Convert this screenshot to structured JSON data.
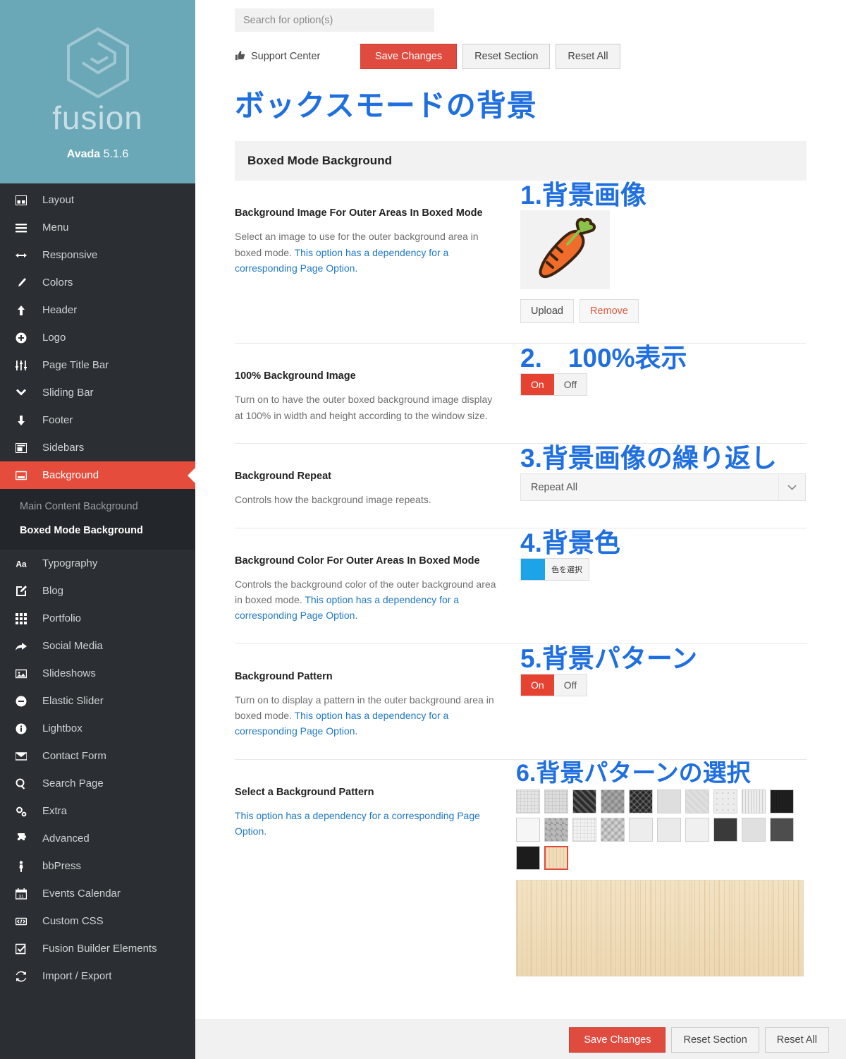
{
  "brand": {
    "wordmark": "fusion",
    "product": "Avada",
    "version": "5.1.6"
  },
  "sidebar": {
    "items": [
      {
        "label": "Layout",
        "icon": "layout-icon"
      },
      {
        "label": "Menu",
        "icon": "menu-icon"
      },
      {
        "label": "Responsive",
        "icon": "arrows-horizontal-icon"
      },
      {
        "label": "Colors",
        "icon": "brush-icon"
      },
      {
        "label": "Header",
        "icon": "arrow-up-icon"
      },
      {
        "label": "Logo",
        "icon": "plus-circle-icon"
      },
      {
        "label": "Page Title Bar",
        "icon": "sliders-icon"
      },
      {
        "label": "Sliding Bar",
        "icon": "chevron-down-icon"
      },
      {
        "label": "Footer",
        "icon": "arrow-down-icon"
      },
      {
        "label": "Sidebars",
        "icon": "sidebars-icon"
      },
      {
        "label": "Background",
        "icon": "background-icon",
        "active": true
      },
      {
        "label": "Typography",
        "icon": "typography-icon"
      },
      {
        "label": "Blog",
        "icon": "pencil-square-icon"
      },
      {
        "label": "Portfolio",
        "icon": "grid-icon"
      },
      {
        "label": "Social Media",
        "icon": "share-arrow-icon"
      },
      {
        "label": "Slideshows",
        "icon": "image-icon"
      },
      {
        "label": "Elastic Slider",
        "icon": "minus-circle-icon"
      },
      {
        "label": "Lightbox",
        "icon": "info-circle-icon"
      },
      {
        "label": "Contact Form",
        "icon": "envelope-icon"
      },
      {
        "label": "Search Page",
        "icon": "search-icon"
      },
      {
        "label": "Extra",
        "icon": "cogs-icon"
      },
      {
        "label": "Advanced",
        "icon": "puzzle-icon"
      },
      {
        "label": "bbPress",
        "icon": "person-icon"
      },
      {
        "label": "Events Calendar",
        "icon": "calendar-icon"
      },
      {
        "label": "Custom CSS",
        "icon": "code-icon"
      },
      {
        "label": "Fusion Builder Elements",
        "icon": "check-square-icon"
      },
      {
        "label": "Import / Export",
        "icon": "refresh-icon"
      }
    ],
    "submenu": [
      {
        "label": "Main Content Background",
        "current": false
      },
      {
        "label": "Boxed Mode Background",
        "current": true
      }
    ]
  },
  "topbar": {
    "search_placeholder": "Search for option(s)",
    "support_center": "Support Center",
    "save": "Save Changes",
    "reset_section": "Reset Section",
    "reset_all": "Reset All"
  },
  "page": {
    "title_jp": "ボックスモードの背景",
    "section_header": "Boxed Mode Background"
  },
  "options": {
    "bg_image": {
      "title": "Background Image For Outer Areas In Boxed Mode",
      "desc_plain": "Select an image to use for the outer background area in boxed mode. ",
      "desc_link": "This option has a dependency for a corresponding Page Option.",
      "annotation": "1.背景画像",
      "preview_icon": "carrot-image",
      "upload": "Upload",
      "remove": "Remove"
    },
    "full_image": {
      "title": "100% Background Image",
      "desc_plain": "Turn on to have the outer boxed background image display at 100% in width and height according to the window size.",
      "annotation": "2.　100%表示",
      "on": "On",
      "off": "Off",
      "value": "On"
    },
    "repeat": {
      "title": "Background Repeat",
      "desc_plain": "Controls how the background image repeats.",
      "annotation": "3.背景画像の繰り返し",
      "value": "Repeat All"
    },
    "bg_color": {
      "title": "Background Color For Outer Areas In Boxed Mode",
      "desc_plain": "Controls the background color of the outer background area in boxed mode. ",
      "desc_link": "This option has a dependency for a corresponding Page Option.",
      "annotation": "4.背景色",
      "swatch_hex": "#1CA3E8",
      "picker_label": "色を選択"
    },
    "bg_pattern": {
      "title": "Background Pattern",
      "desc_plain": "Turn on to display a pattern in the outer background area in boxed mode. ",
      "desc_link": "This option has a dependency for a corresponding Page Option.",
      "annotation": "5.背景パターン",
      "on": "On",
      "off": "Off",
      "value": "On"
    },
    "select_pattern": {
      "title": "Select a Background Pattern",
      "desc_link": "This option has a dependency for a corresponding Page Option.",
      "annotation": "6.背景パターンの選択",
      "selected_index": 21,
      "swatches": [
        {
          "name": "pattern-1",
          "color": "#e4e4e4",
          "style": "fine-grid"
        },
        {
          "name": "pattern-2",
          "color": "#dcdcdc",
          "style": "fine-grid"
        },
        {
          "name": "pattern-3",
          "color": "#2b2b2b",
          "style": "diagonal"
        },
        {
          "name": "pattern-4",
          "color": "#a8a8a8",
          "style": "chevron"
        },
        {
          "name": "pattern-5",
          "color": "#262626",
          "style": "cross"
        },
        {
          "name": "pattern-6",
          "color": "#dedede",
          "style": "plain"
        },
        {
          "name": "pattern-7",
          "color": "#d8d8d8",
          "style": "diagonal"
        },
        {
          "name": "pattern-8",
          "color": "#ececec",
          "style": "dots"
        },
        {
          "name": "pattern-9",
          "color": "#ededed",
          "style": "vertical"
        },
        {
          "name": "pattern-10",
          "color": "#1f1f1f",
          "style": "vertical"
        },
        {
          "name": "pattern-11",
          "color": "#f6f6f6",
          "style": "plain"
        },
        {
          "name": "pattern-12",
          "color": "#b8b8b8",
          "style": "checker"
        },
        {
          "name": "pattern-13",
          "color": "#f2f2f2",
          "style": "fine-grid"
        },
        {
          "name": "pattern-14",
          "color": "#d2d2d2",
          "style": "chevron"
        },
        {
          "name": "pattern-15",
          "color": "#ededed",
          "style": "plain"
        },
        {
          "name": "pattern-16",
          "color": "#eaeaea",
          "style": "plain"
        },
        {
          "name": "pattern-17",
          "color": "#f0f0f0",
          "style": "plain"
        },
        {
          "name": "pattern-18",
          "color": "#3a3a3a",
          "style": "plain"
        },
        {
          "name": "pattern-19",
          "color": "#e0e0e0",
          "style": "plain"
        },
        {
          "name": "pattern-20",
          "color": "#4d4d4d",
          "style": "plain"
        },
        {
          "name": "pattern-21",
          "color": "#1c1c1c",
          "style": "plain"
        },
        {
          "name": "pattern-22",
          "color": "#f0dcb8",
          "style": "wood"
        }
      ]
    }
  },
  "footer": {
    "save": "Save Changes",
    "reset_section": "Reset Section",
    "reset_all": "Reset All"
  },
  "colors": {
    "accent_red": "#e64c3c",
    "brand_teal": "#6aa8b8",
    "annotation_blue": "#1f6fe0",
    "link_blue": "#2079c4"
  }
}
